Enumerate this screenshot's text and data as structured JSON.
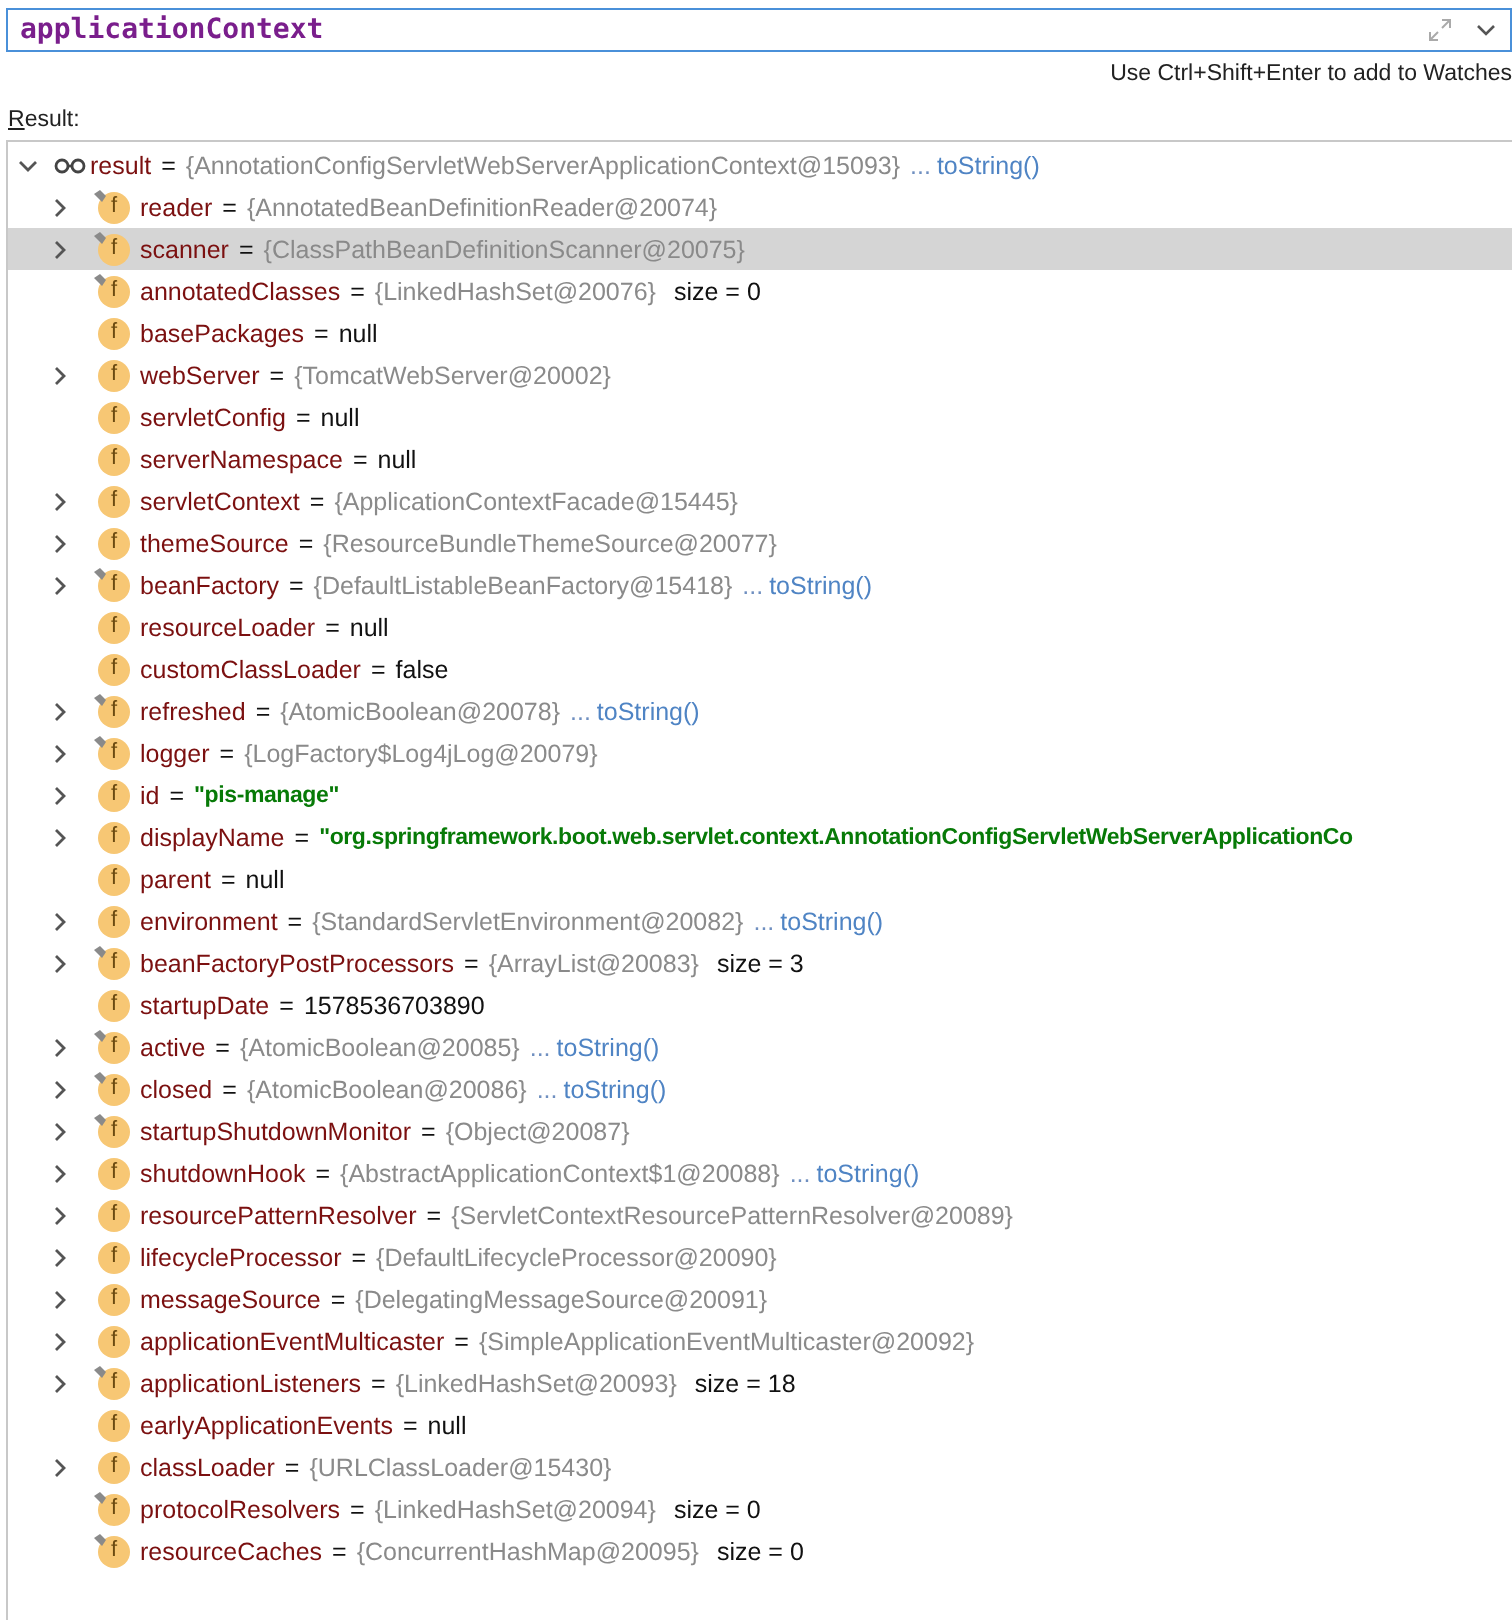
{
  "search": {
    "value": "applicationContext"
  },
  "hint": "Use Ctrl+Shift+Enter to add to Watches",
  "result_label": "Result:",
  "tree": {
    "name": "result",
    "op": "=",
    "value": "{AnnotationConfigServletWebServerApplicationContext@15093}",
    "kind": "ref",
    "ellipsis": "...",
    "to_string": "toString()",
    "expanded": true,
    "selected": false,
    "children": [
      {
        "name": "reader",
        "op": "=",
        "value": "{AnnotatedBeanDefinitionReader@20074}",
        "kind": "ref",
        "badge": "f",
        "final": true,
        "expandable": true,
        "selected": false
      },
      {
        "name": "scanner",
        "op": "=",
        "value": "{ClassPathBeanDefinitionScanner@20075}",
        "kind": "ref",
        "badge": "f",
        "final": true,
        "expandable": true,
        "selected": true
      },
      {
        "name": "annotatedClasses",
        "op": "=",
        "value": "{LinkedHashSet@20076}",
        "kind": "ref",
        "size": "size = 0",
        "badge": "f",
        "final": true,
        "expandable": false,
        "selected": false
      },
      {
        "name": "basePackages",
        "op": "=",
        "value": "null",
        "kind": "plain",
        "badge": "f",
        "final": false,
        "expandable": false,
        "selected": false
      },
      {
        "name": "webServer",
        "op": "=",
        "value": "{TomcatWebServer@20002}",
        "kind": "ref",
        "badge": "f",
        "final": false,
        "expandable": true,
        "selected": false
      },
      {
        "name": "servletConfig",
        "op": "=",
        "value": "null",
        "kind": "plain",
        "badge": "f",
        "final": false,
        "expandable": false,
        "selected": false
      },
      {
        "name": "serverNamespace",
        "op": "=",
        "value": "null",
        "kind": "plain",
        "badge": "f",
        "final": false,
        "expandable": false,
        "selected": false
      },
      {
        "name": "servletContext",
        "op": "=",
        "value": "{ApplicationContextFacade@15445}",
        "kind": "ref",
        "badge": "f",
        "final": false,
        "expandable": true,
        "selected": false
      },
      {
        "name": "themeSource",
        "op": "=",
        "value": "{ResourceBundleThemeSource@20077}",
        "kind": "ref",
        "badge": "f",
        "final": false,
        "expandable": true,
        "selected": false
      },
      {
        "name": "beanFactory",
        "op": "=",
        "value": "{DefaultListableBeanFactory@15418}",
        "kind": "ref",
        "ellipsis": "...",
        "to_string": "toString()",
        "badge": "f",
        "final": true,
        "expandable": true,
        "selected": false
      },
      {
        "name": "resourceLoader",
        "op": "=",
        "value": "null",
        "kind": "plain",
        "badge": "f",
        "final": false,
        "expandable": false,
        "selected": false
      },
      {
        "name": "customClassLoader",
        "op": "=",
        "value": "false",
        "kind": "plain",
        "badge": "f",
        "final": false,
        "expandable": false,
        "selected": false
      },
      {
        "name": "refreshed",
        "op": "=",
        "value": "{AtomicBoolean@20078}",
        "kind": "ref",
        "ellipsis": "...",
        "to_string": "toString()",
        "badge": "f",
        "final": true,
        "expandable": true,
        "selected": false
      },
      {
        "name": "logger",
        "op": "=",
        "value": "{LogFactory$Log4jLog@20079}",
        "kind": "ref",
        "badge": "f",
        "final": true,
        "expandable": true,
        "selected": false
      },
      {
        "name": "id",
        "op": "=",
        "value": "\"pis-manage\"",
        "kind": "string",
        "badge": "f",
        "final": false,
        "expandable": true,
        "selected": false
      },
      {
        "name": "displayName",
        "op": "=",
        "value": "\"org.springframework.boot.web.servlet.context.AnnotationConfigServletWebServerApplicationCo",
        "kind": "string",
        "badge": "f",
        "final": false,
        "expandable": true,
        "selected": false
      },
      {
        "name": "parent",
        "op": "=",
        "value": "null",
        "kind": "plain",
        "badge": "f",
        "final": false,
        "expandable": false,
        "selected": false
      },
      {
        "name": "environment",
        "op": "=",
        "value": "{StandardServletEnvironment@20082}",
        "kind": "ref",
        "ellipsis": "...",
        "to_string": "toString()",
        "badge": "f",
        "final": false,
        "expandable": true,
        "selected": false
      },
      {
        "name": "beanFactoryPostProcessors",
        "op": "=",
        "value": "{ArrayList@20083}",
        "kind": "ref",
        "size": "size = 3",
        "badge": "f",
        "final": true,
        "expandable": true,
        "selected": false
      },
      {
        "name": "startupDate",
        "op": "=",
        "value": "1578536703890",
        "kind": "plain",
        "badge": "f",
        "final": false,
        "expandable": false,
        "selected": false
      },
      {
        "name": "active",
        "op": "=",
        "value": "{AtomicBoolean@20085}",
        "kind": "ref",
        "ellipsis": "...",
        "to_string": "toString()",
        "badge": "f",
        "final": true,
        "expandable": true,
        "selected": false
      },
      {
        "name": "closed",
        "op": "=",
        "value": "{AtomicBoolean@20086}",
        "kind": "ref",
        "ellipsis": "...",
        "to_string": "toString()",
        "badge": "f",
        "final": true,
        "expandable": true,
        "selected": false
      },
      {
        "name": "startupShutdownMonitor",
        "op": "=",
        "value": "{Object@20087}",
        "kind": "ref",
        "badge": "f",
        "final": true,
        "expandable": true,
        "selected": false
      },
      {
        "name": "shutdownHook",
        "op": "=",
        "value": "{AbstractApplicationContext$1@20088}",
        "kind": "ref",
        "ellipsis": "...",
        "to_string": "toString()",
        "badge": "f",
        "final": false,
        "expandable": true,
        "selected": false
      },
      {
        "name": "resourcePatternResolver",
        "op": "=",
        "value": "{ServletContextResourcePatternResolver@20089}",
        "kind": "ref",
        "badge": "f",
        "final": false,
        "expandable": true,
        "selected": false
      },
      {
        "name": "lifecycleProcessor",
        "op": "=",
        "value": "{DefaultLifecycleProcessor@20090}",
        "kind": "ref",
        "badge": "f",
        "final": false,
        "expandable": true,
        "selected": false
      },
      {
        "name": "messageSource",
        "op": "=",
        "value": "{DelegatingMessageSource@20091}",
        "kind": "ref",
        "badge": "f",
        "final": false,
        "expandable": true,
        "selected": false
      },
      {
        "name": "applicationEventMulticaster",
        "op": "=",
        "value": "{SimpleApplicationEventMulticaster@20092}",
        "kind": "ref",
        "badge": "f",
        "final": false,
        "expandable": true,
        "selected": false
      },
      {
        "name": "applicationListeners",
        "op": "=",
        "value": "{LinkedHashSet@20093}",
        "kind": "ref",
        "size": "size = 18",
        "badge": "f",
        "final": true,
        "expandable": true,
        "selected": false
      },
      {
        "name": "earlyApplicationEvents",
        "op": "=",
        "value": "null",
        "kind": "plain",
        "badge": "f",
        "final": false,
        "expandable": false,
        "selected": false
      },
      {
        "name": "classLoader",
        "op": "=",
        "value": "{URLClassLoader@15430}",
        "kind": "ref",
        "badge": "f",
        "final": false,
        "expandable": true,
        "selected": false
      },
      {
        "name": "protocolResolvers",
        "op": "=",
        "value": "{LinkedHashSet@20094}",
        "kind": "ref",
        "size": "size = 0",
        "badge": "f",
        "final": true,
        "expandable": false,
        "selected": false
      },
      {
        "name": "resourceCaches",
        "op": "=",
        "value": "{ConcurrentHashMap@20095}",
        "kind": "ref",
        "size": "size = 0",
        "badge": "f",
        "final": true,
        "expandable": false,
        "selected": false
      }
    ]
  }
}
